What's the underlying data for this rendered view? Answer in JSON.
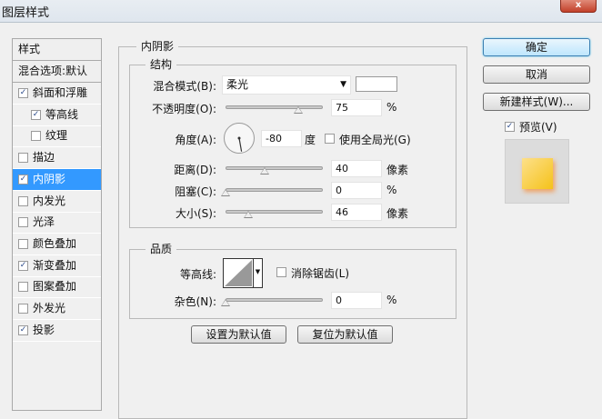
{
  "window": {
    "title": "图层样式",
    "close": "x"
  },
  "styles_panel": {
    "header": "样式",
    "blend_options": "混合选项:默认",
    "items": [
      {
        "label": "斜面和浮雕",
        "checked": true,
        "indent": false
      },
      {
        "label": "等高线",
        "checked": true,
        "indent": true
      },
      {
        "label": "纹理",
        "checked": false,
        "indent": true
      },
      {
        "label": "描边",
        "checked": false,
        "indent": false
      },
      {
        "label": "内阴影",
        "checked": true,
        "indent": false,
        "selected": true
      },
      {
        "label": "内发光",
        "checked": false,
        "indent": false
      },
      {
        "label": "光泽",
        "checked": false,
        "indent": false
      },
      {
        "label": "颜色叠加",
        "checked": false,
        "indent": false
      },
      {
        "label": "渐变叠加",
        "checked": true,
        "indent": false
      },
      {
        "label": "图案叠加",
        "checked": false,
        "indent": false
      },
      {
        "label": "外发光",
        "checked": false,
        "indent": false
      },
      {
        "label": "投影",
        "checked": true,
        "indent": false
      }
    ]
  },
  "main": {
    "title": "内阴影",
    "structure": {
      "legend": "结构",
      "blend_mode": {
        "label": "混合模式(B):",
        "value": "柔光",
        "color": "#ffffff"
      },
      "opacity": {
        "label": "不透明度(O):",
        "value": "75",
        "unit": "%",
        "percent": 75
      },
      "angle": {
        "label": "角度(A):",
        "value": "-80",
        "unit": "度",
        "global_light_label": "使用全局光(G)",
        "global_light": false
      },
      "distance": {
        "label": "距离(D):",
        "value": "40",
        "unit": "像素",
        "fraction": 0.4
      },
      "choke": {
        "label": "阻塞(C):",
        "value": "0",
        "unit": "%",
        "fraction": 0
      },
      "size": {
        "label": "大小(S):",
        "value": "46",
        "unit": "像素",
        "fraction": 0.23
      }
    },
    "quality": {
      "legend": "品质",
      "contour_label": "等高线:",
      "anti_alias_label": "消除锯齿(L)",
      "anti_alias": false,
      "noise": {
        "label": "杂色(N):",
        "value": "0",
        "unit": "%",
        "fraction": 0
      }
    },
    "set_default": "设置为默认值",
    "reset_default": "复位为默认值"
  },
  "right": {
    "ok": "确定",
    "cancel": "取消",
    "new_style": "新建样式(W)...",
    "preview_label": "预览(V)",
    "preview": true
  }
}
